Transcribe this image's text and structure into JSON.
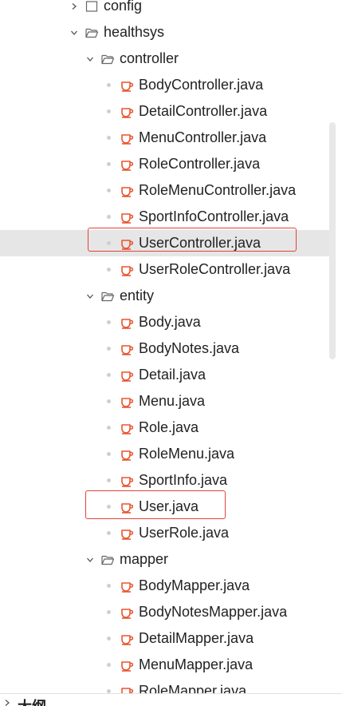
{
  "tree": [
    {
      "label": "config",
      "type": "folder",
      "expanded": false
    },
    {
      "label": "healthsys",
      "type": "folder",
      "expanded": true
    },
    {
      "label": "controller",
      "type": "folder",
      "expanded": true
    },
    {
      "label": "BodyController.java",
      "type": "java"
    },
    {
      "label": "DetailController.java",
      "type": "java"
    },
    {
      "label": "MenuController.java",
      "type": "java"
    },
    {
      "label": "RoleController.java",
      "type": "java"
    },
    {
      "label": "RoleMenuController.java",
      "type": "java"
    },
    {
      "label": "SportInfoController.java",
      "type": "java"
    },
    {
      "label": "UserController.java",
      "type": "java",
      "selected": true,
      "highlighted": true
    },
    {
      "label": "UserRoleController.java",
      "type": "java"
    },
    {
      "label": "entity",
      "type": "folder",
      "expanded": true
    },
    {
      "label": "Body.java",
      "type": "java"
    },
    {
      "label": "BodyNotes.java",
      "type": "java"
    },
    {
      "label": "Detail.java",
      "type": "java"
    },
    {
      "label": "Menu.java",
      "type": "java"
    },
    {
      "label": "Role.java",
      "type": "java"
    },
    {
      "label": "RoleMenu.java",
      "type": "java"
    },
    {
      "label": "SportInfo.java",
      "type": "java"
    },
    {
      "label": "User.java",
      "type": "java",
      "highlighted": true
    },
    {
      "label": "UserRole.java",
      "type": "java"
    },
    {
      "label": "mapper",
      "type": "folder",
      "expanded": true
    },
    {
      "label": "BodyMapper.java",
      "type": "java"
    },
    {
      "label": "BodyNotesMapper.java",
      "type": "java"
    },
    {
      "label": "DetailMapper.java",
      "type": "java"
    },
    {
      "label": "MenuMapper.java",
      "type": "java"
    },
    {
      "label": "RoleMapper.java",
      "type": "java"
    }
  ],
  "bottom_panel": {
    "title": "大纲",
    "expanded": false
  },
  "colors": {
    "java_icon": "#e8552f",
    "highlight_box": "#e0453a",
    "selected_row": "#e6e6e6"
  },
  "icons": {
    "folder": "folder-icon",
    "folder_open": "folder-open-icon",
    "java": "java-coffee-icon"
  }
}
